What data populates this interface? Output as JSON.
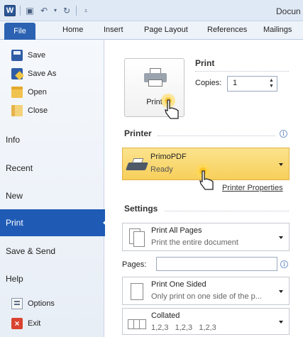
{
  "titlebar": {
    "app_icon_letter": "W",
    "doc_title": "Docun"
  },
  "ribbon": {
    "tabs": [
      {
        "label": "File",
        "active": true
      },
      {
        "label": "Home"
      },
      {
        "label": "Insert"
      },
      {
        "label": "Page Layout"
      },
      {
        "label": "References"
      },
      {
        "label": "Mailings"
      }
    ]
  },
  "backstage": {
    "commands": [
      {
        "label": "Save",
        "icon": "save-icon"
      },
      {
        "label": "Save As",
        "icon": "save-as-icon"
      },
      {
        "label": "Open",
        "icon": "open-folder-icon"
      },
      {
        "label": "Close",
        "icon": "close-folder-icon"
      }
    ],
    "items": [
      {
        "label": "Info"
      },
      {
        "label": "Recent"
      },
      {
        "label": "New"
      },
      {
        "label": "Print",
        "active": true
      },
      {
        "label": "Save & Send"
      },
      {
        "label": "Help"
      }
    ],
    "bottom_commands": [
      {
        "label": "Options",
        "icon": "options-icon"
      },
      {
        "label": "Exit",
        "icon": "exit-icon"
      }
    ]
  },
  "print": {
    "heading": "Print",
    "button_label": "Print",
    "copies_label": "Copies:",
    "copies_value": "1",
    "printer_heading": "Printer",
    "printer": {
      "name": "PrimoPDF",
      "status": "Ready"
    },
    "printer_properties": "Printer Properties",
    "settings_heading": "Settings",
    "settings": [
      {
        "title": "Print All Pages",
        "subtitle": "Print the entire document"
      },
      {
        "title": "Print One Sided",
        "subtitle": "Only print on one side of the p..."
      },
      {
        "title": "Collated",
        "subtitle": "1,2,3   1,2,3   1,2,3"
      }
    ],
    "pages_label": "Pages:",
    "pages_value": ""
  },
  "colors": {
    "file_tab": "#2b62b2",
    "active_nav": "#1f5bb5",
    "printer_highlight": "#f7cf5b"
  }
}
